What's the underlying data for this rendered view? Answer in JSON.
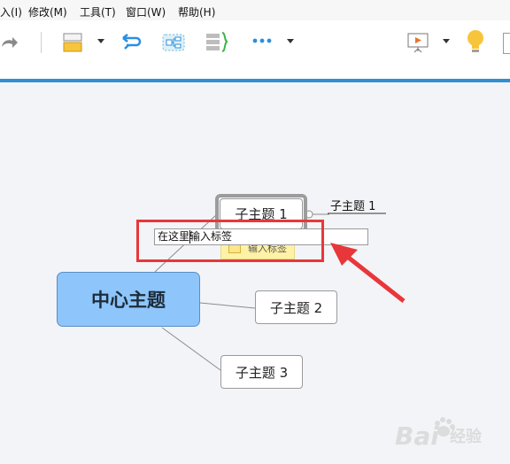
{
  "menubar": {
    "items": [
      "入(I)",
      "修改(M)",
      "工具(T)",
      "窗口(W)",
      "帮助(H)"
    ]
  },
  "toolbar": {
    "icons": [
      "redo-icon",
      "topic-style-icon",
      "relationship-icon",
      "boundary-icon",
      "summary-icon",
      "more-icon",
      "presentation-icon",
      "lightbulb-icon"
    ],
    "colors": {
      "accent_line": "#2f8fd1",
      "blue_icon": "#2a8fe0",
      "yellow_icon": "#f7c53b"
    }
  },
  "mindmap": {
    "central_topic": "中心主题",
    "subtopic_1": "子主题 1",
    "subtopic_2": "子主题 2",
    "subtopic_3": "子主题 3",
    "floating_subtopic": "子主题 1",
    "label_placeholder_sticker": "输入标签",
    "label_input_value": "在这里输入标签",
    "colors": {
      "central_fill": "#8ec5fa",
      "highlight": "#e8373a",
      "arrow": "#e8373a"
    }
  },
  "watermark": {
    "brand": "Bai",
    "brand_suffix": "经验"
  }
}
